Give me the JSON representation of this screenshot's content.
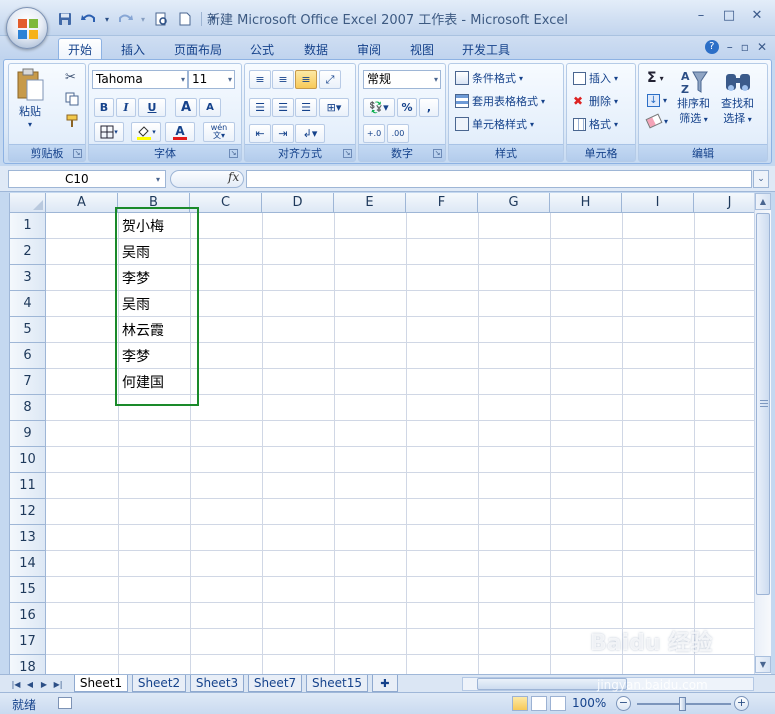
{
  "window": {
    "title": "新建 Microsoft Office Excel 2007 工作表 - Microsoft Excel"
  },
  "quick_access": {
    "dropdown": "▾"
  },
  "ribbon_tabs": [
    "开始",
    "插入",
    "页面布局",
    "公式",
    "数据",
    "审阅",
    "视图",
    "开发工具"
  ],
  "active_tab": "开始",
  "ribbon": {
    "clipboard": {
      "label": "剪贴板",
      "paste": "粘贴"
    },
    "font": {
      "label": "字体",
      "font_name": "Tahoma",
      "font_size": "11",
      "bold": "B",
      "italic": "I",
      "underline": "U",
      "grow": "A",
      "shrink": "A",
      "font_color": "A",
      "wen": "wén"
    },
    "alignment": {
      "label": "对齐方式"
    },
    "number": {
      "label": "数字",
      "format": "常规",
      "percent": "%",
      "comma": ","
    },
    "styles": {
      "label": "样式",
      "conditional": "条件格式",
      "table": "套用表格格式",
      "cell_styles": "单元格样式"
    },
    "cells": {
      "label": "单元格",
      "insert": "插入",
      "delete": "删除",
      "format": "格式"
    },
    "editing": {
      "label": "编辑",
      "sum": "Σ",
      "sort_line1": "排序和",
      "sort_line2": "筛选",
      "find_line1": "查找和",
      "find_line2": "选择"
    }
  },
  "formula_bar": {
    "name_box": "C10",
    "fx": "fx",
    "formula": ""
  },
  "columns": [
    "A",
    "B",
    "C",
    "D",
    "E",
    "F",
    "G",
    "H",
    "I",
    "J"
  ],
  "rows": [
    "1",
    "2",
    "3",
    "4",
    "5",
    "6",
    "7",
    "8",
    "9",
    "10",
    "11",
    "12",
    "13",
    "14",
    "15",
    "16",
    "17",
    "18"
  ],
  "cells_b": [
    "贺小梅",
    "吴雨",
    "李梦",
    "吴雨",
    "林云霞",
    "李梦",
    "何建国"
  ],
  "sheets": [
    "Sheet1",
    "Sheet2",
    "Sheet3",
    "Sheet7",
    "Sheet15"
  ],
  "active_sheet": "Sheet1",
  "status": {
    "ready": "就绪",
    "zoom": "100%"
  },
  "watermark": {
    "main": "Baidu 经验",
    "sub": "jingyan.baidu.com"
  }
}
